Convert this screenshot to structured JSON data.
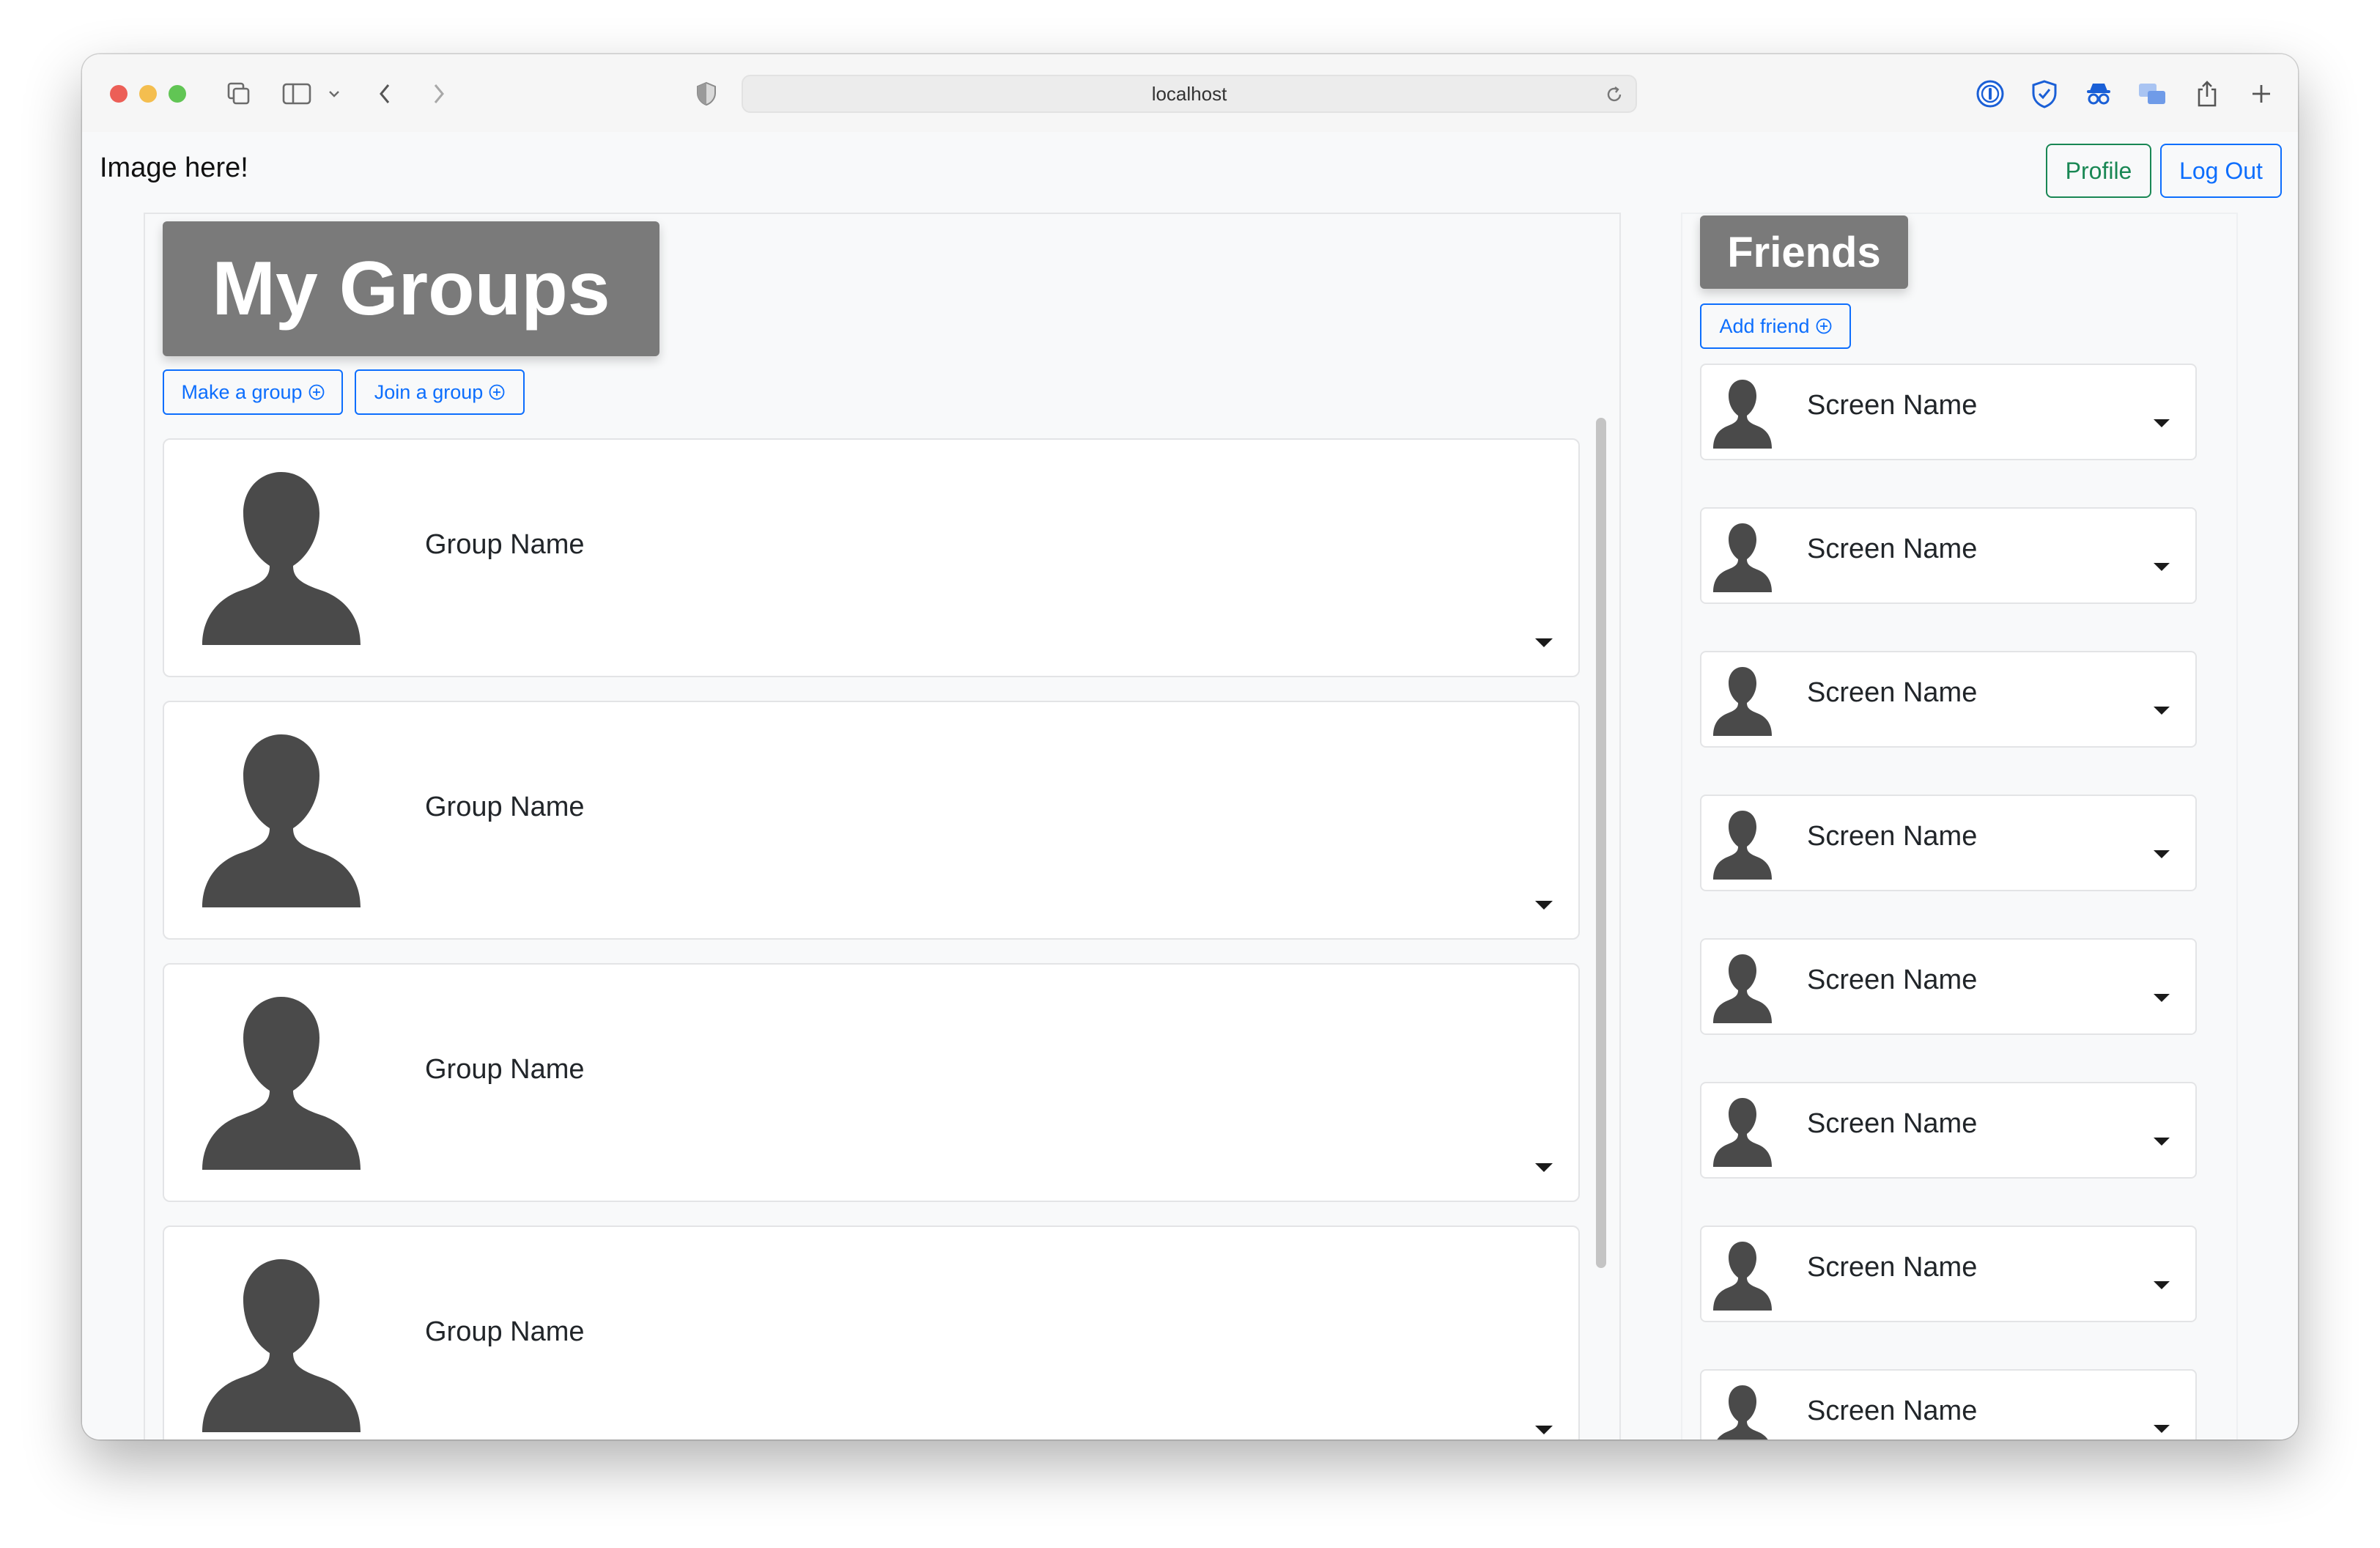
{
  "browser": {
    "url": "localhost"
  },
  "navbar": {
    "brand": "Image here!",
    "profile_label": "Profile",
    "logout_label": "Log Out"
  },
  "groups": {
    "title": "My Groups",
    "make_group_label": "Make a group",
    "join_group_label": "Join a group",
    "items": [
      {
        "name": "Group Name"
      },
      {
        "name": "Group Name"
      },
      {
        "name": "Group Name"
      },
      {
        "name": "Group Name"
      }
    ]
  },
  "friends": {
    "title": "Friends",
    "add_friend_label": "Add friend",
    "items": [
      {
        "name": "Screen Name"
      },
      {
        "name": "Screen Name"
      },
      {
        "name": "Screen Name"
      },
      {
        "name": "Screen Name"
      },
      {
        "name": "Screen Name"
      },
      {
        "name": "Screen Name"
      },
      {
        "name": "Screen Name"
      },
      {
        "name": "Screen Name"
      }
    ]
  },
  "colors": {
    "title_bg": "#7a7a7a",
    "primary": "#0d6efd",
    "success": "#198754",
    "avatar": "#4a4a4a"
  }
}
